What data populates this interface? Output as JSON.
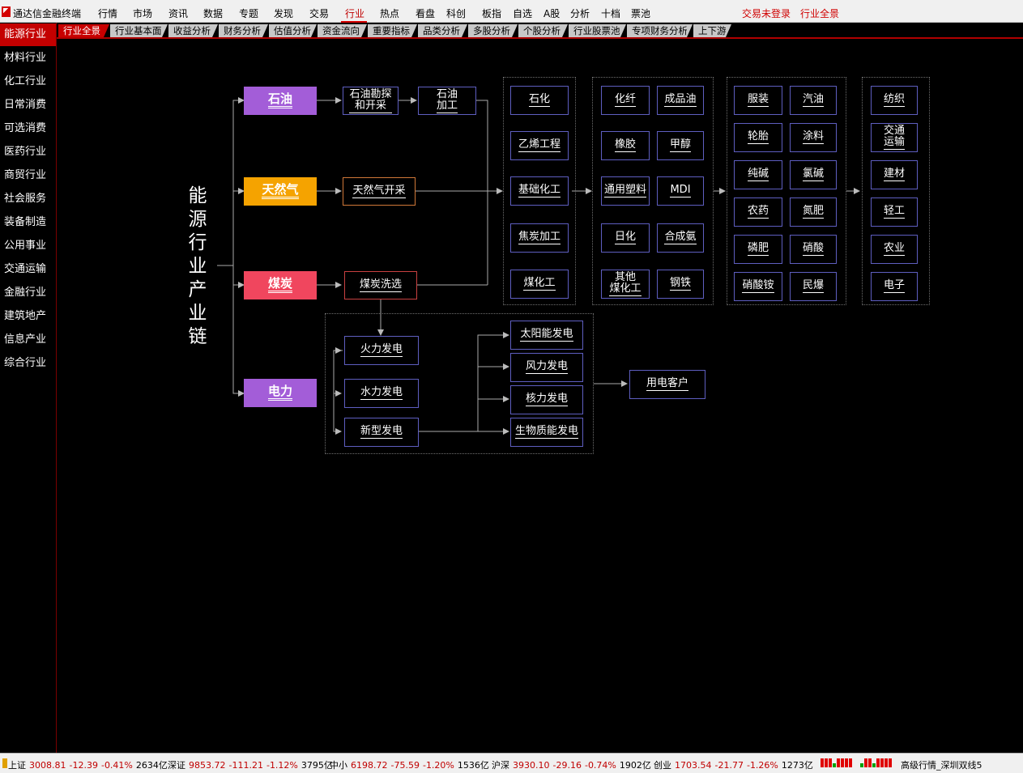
{
  "app": {
    "title": "通达信金融终端",
    "menu": [
      "行情",
      "市场",
      "资讯",
      "数据",
      "专题",
      "发现",
      "交易",
      "行业",
      "热点",
      "看盘",
      "科创",
      "板指",
      "自选",
      "A股",
      "分析",
      "十档",
      "票池"
    ],
    "active_menu": "行业",
    "right_links": [
      "交易未登录",
      "行业全景"
    ]
  },
  "tabs": [
    "行业全景",
    "行业基本面",
    "收益分析",
    "财务分析",
    "估值分析",
    "资金流向",
    "重要指标",
    "品类分析",
    "多股分析",
    "个股分析",
    "行业股票池",
    "专项财务分析",
    "上下游"
  ],
  "active_tab": "行业全景",
  "sidebar": {
    "items": [
      "能源行业",
      "材料行业",
      "化工行业",
      "日常消费",
      "可选消费",
      "医药行业",
      "商贸行业",
      "社会服务",
      "装备制造",
      "公用事业",
      "交通运输",
      "金融行业",
      "建筑地产",
      "信息产业",
      "综合行业"
    ],
    "active": "能源行业"
  },
  "chain": {
    "title": "能源行业产业链",
    "sources": [
      "石油",
      "天然气",
      "煤炭",
      "电力"
    ],
    "source_colors": [
      "#a35dd8",
      "#f5a300",
      "#f0465e",
      "#a35dd8"
    ],
    "oil_steps": [
      "石油勘探\n和开采",
      "石油\n加工"
    ],
    "gas_steps": [
      "天然气开采"
    ],
    "coal_steps": [
      "煤炭洗选"
    ],
    "group1": [
      "石化",
      "乙烯工程",
      "基础化工",
      "焦炭加工",
      "煤化工"
    ],
    "group2": [
      "化纤",
      "成品油",
      "橡胶",
      "甲醇",
      "通用塑料",
      "MDI",
      "日化",
      "合成氨",
      "其他\n煤化工",
      "钢铁"
    ],
    "group3": [
      "服装",
      "汽油",
      "轮胎",
      "涂料",
      "纯碱",
      "氯碱",
      "农药",
      "氮肥",
      "磷肥",
      "硝酸",
      "硝酸铵",
      "民爆"
    ],
    "group4": [
      "纺织",
      "交通\n运输",
      "建材",
      "轻工",
      "农业",
      "电子"
    ],
    "power_gen": [
      "火力发电",
      "水力发电",
      "新型发电"
    ],
    "power_new": [
      "太阳能发电",
      "风力发电",
      "核力发电",
      "生物质能发电"
    ],
    "power_end": "用电客户"
  },
  "status": {
    "items": [
      {
        "name": "上证",
        "value": "3008.81",
        "chg": "-12.39",
        "pct": "-0.41%",
        "vol": "2634亿"
      },
      {
        "name": "深证",
        "value": "9853.72",
        "chg": "-111.21",
        "pct": "-1.12%",
        "vol": "3795亿"
      },
      {
        "name": "中小",
        "value": "6198.72",
        "chg": "-75.59",
        "pct": "-1.20%",
        "vol": "1536亿"
      },
      {
        "name": "沪深",
        "value": "3930.10",
        "chg": "-29.16",
        "pct": "-0.74%",
        "vol": "1902亿"
      },
      {
        "name": "创业",
        "value": "1703.54",
        "chg": "-21.77",
        "pct": "-1.26%",
        "vol": "1273亿"
      }
    ],
    "server": "高级行情_深圳双线5"
  }
}
